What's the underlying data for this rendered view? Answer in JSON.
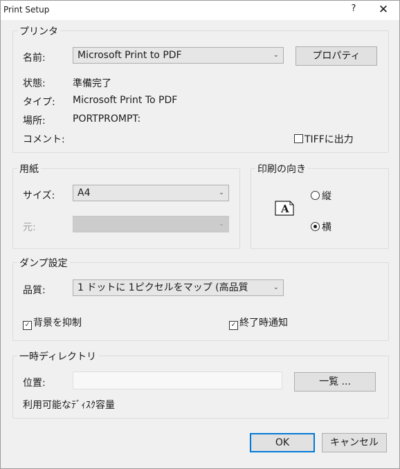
{
  "window": {
    "title": "Print Setup",
    "help": "?",
    "close": "✕"
  },
  "printer": {
    "group": "プリンタ",
    "name_label": "名前:",
    "name_value": "Microsoft Print to PDF",
    "properties_button": "プロパティ",
    "status_label": "状態:",
    "status_value": "準備完了",
    "type_label": "タイプ:",
    "type_value": "Microsoft Print To PDF",
    "location_label": "場所:",
    "location_value": "PORTPROMPT:",
    "comment_label": "コメント:",
    "tiff_label": "TIFFに出力"
  },
  "paper": {
    "group": "用紙",
    "size_label": "サイズ:",
    "size_value": "A4",
    "source_label": "元:",
    "source_value": ""
  },
  "orientation": {
    "group": "印刷の向き",
    "portrait": "縦",
    "landscape": "横",
    "selected": "landscape"
  },
  "dump": {
    "group": "ダンプ設定",
    "quality_label": "品質:",
    "quality_value": "1 ドットに 1ピクセルをマップ (高品質",
    "suppress_bg": "背景を抑制",
    "notify_end": "終了時通知"
  },
  "temp": {
    "group": "一時ディレクトリ",
    "location_label": "位置:",
    "location_value": "",
    "browse_button": "一覧 ...",
    "disk_label": "利用可能なﾃﾞｨｽｸ容量"
  },
  "buttons": {
    "ok": "OK",
    "cancel": "キャンセル"
  }
}
